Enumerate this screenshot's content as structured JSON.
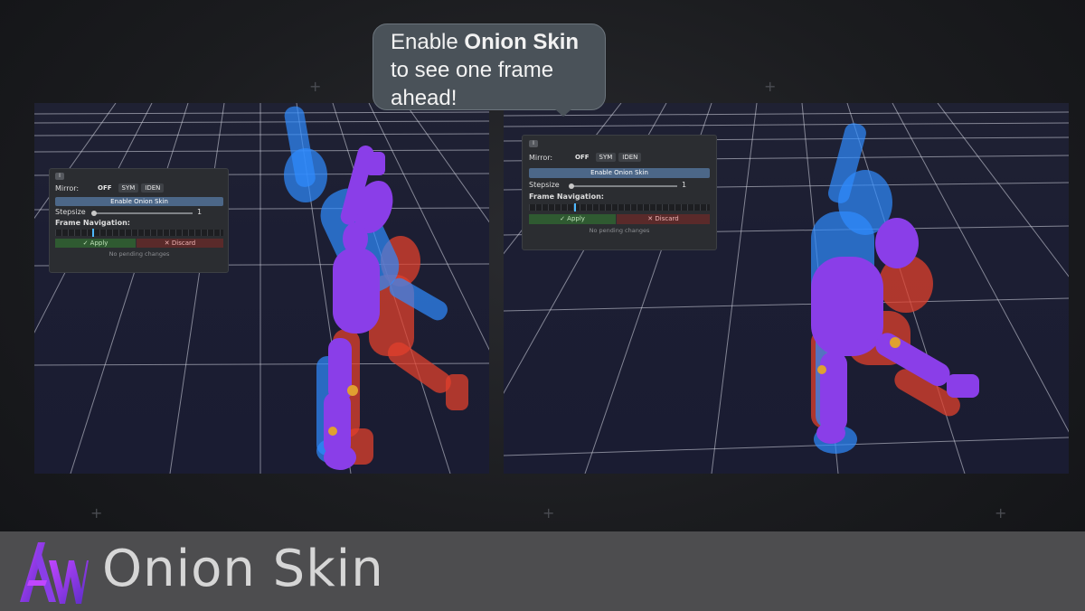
{
  "callout": {
    "line1_prefix": "Enable ",
    "line1_bold": "Onion Skin",
    "line2": "to see one frame",
    "line3": "ahead!"
  },
  "panel_left": {
    "header_icon": "I",
    "mirror_label": "Mirror:",
    "mirror_off": "OFF",
    "mirror_sym": "SYM",
    "mirror_iden": "IDEN",
    "onion_button": "Enable Onion Skin",
    "stepsize_label": "Stepsize",
    "stepsize_value": "1",
    "frame_nav_label": "Frame Navigation:",
    "apply_label": "✓ Apply",
    "discard_label": "✕ Discard",
    "pending_text": "No pending changes"
  },
  "panel_right": {
    "header_icon": "I",
    "mirror_label": "Mirror:",
    "mirror_off": "OFF",
    "mirror_sym": "SYM",
    "mirror_iden": "IDEN",
    "onion_button": "Enable Onion Skin",
    "stepsize_label": "Stepsize",
    "stepsize_value": "1",
    "frame_nav_label": "Frame Navigation:",
    "apply_label": "✓ Apply",
    "discard_label": "✕ Discard",
    "pending_text": "No pending changes"
  },
  "footer": {
    "title": "Onion Skin",
    "logo_icon": "aw-logo-icon"
  },
  "colors": {
    "accent_blue": "#4c6788",
    "apply_green": "#2f5a31",
    "discard_red": "#5a2a2a",
    "figure_purple": "#8a3ee8",
    "ghost_blue": "#2f8bff",
    "ghost_red": "#e0402c"
  }
}
